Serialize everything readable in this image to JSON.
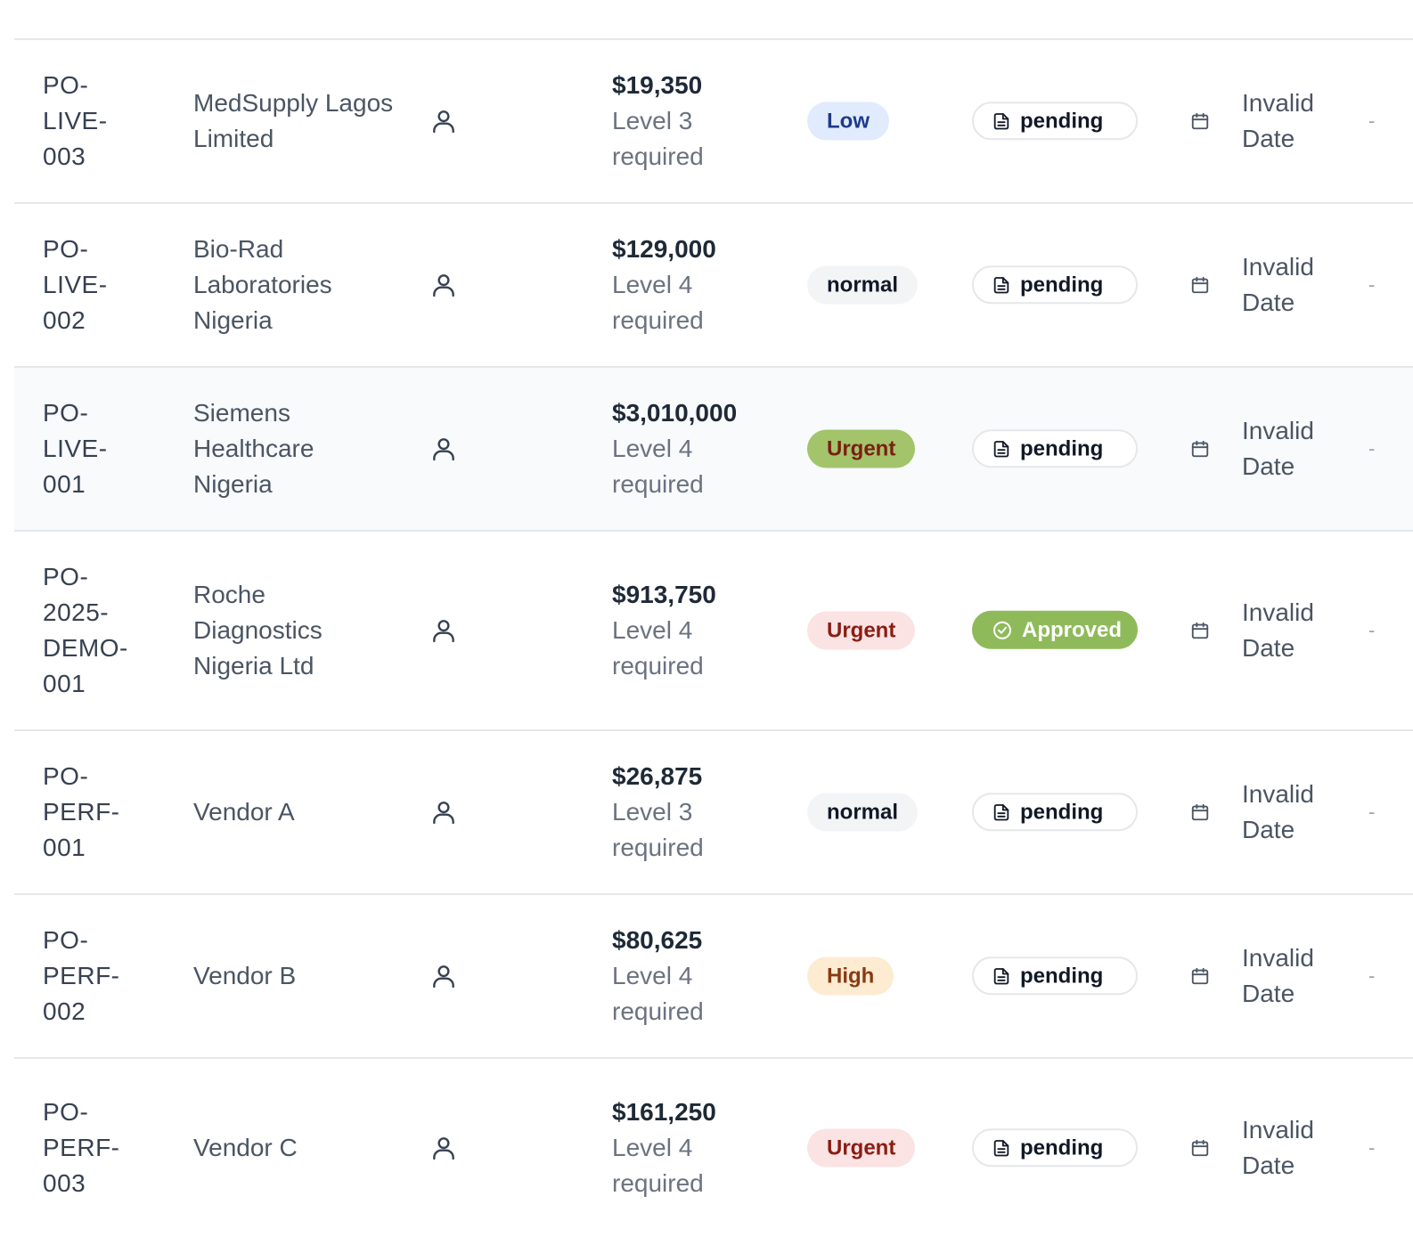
{
  "header": {
    "col_po": "",
    "col_vendor": "",
    "col_amount": ""
  },
  "orders": [
    {
      "po_number": "PO-\nLIVE-\n003",
      "vendor": "MedSupply Lagos Limited",
      "amount": "$19,350",
      "approval_level": "Level 3 required",
      "priority": "Low",
      "priority_style": "low",
      "status": "pending",
      "status_style": "pending",
      "date": "Invalid Date",
      "extra": "-"
    },
    {
      "po_number": "PO-\nLIVE-\n002",
      "vendor": "Bio-Rad Laboratories Nigeria",
      "amount": "$129,000",
      "approval_level": "Level 4 required",
      "priority": "normal",
      "priority_style": "normal",
      "status": "pending",
      "status_style": "pending",
      "date": "Invalid Date",
      "extra": "-"
    },
    {
      "po_number": "PO-\nLIVE-\n001",
      "vendor": "Siemens Healthcare Nigeria",
      "amount": "$3,010,000",
      "approval_level": "Level 4 required",
      "priority": "Urgent",
      "priority_style": "urgent-solid",
      "status": "pending",
      "status_style": "pending",
      "date": "Invalid Date",
      "extra": "-"
    },
    {
      "po_number": "PO-\n2025-\nDEMO-\n001",
      "vendor": "Roche Diagnostics Nigeria Ltd",
      "amount": "$913,750",
      "approval_level": "Level 4 required",
      "priority": "Urgent",
      "priority_style": "urgent-soft",
      "status": "Approved",
      "status_style": "approved",
      "date": "Invalid Date",
      "extra": "-"
    },
    {
      "po_number": "PO-\nPERF-\n001",
      "vendor": "Vendor A",
      "amount": "$26,875",
      "approval_level": "Level 3 required",
      "priority": "normal",
      "priority_style": "normal",
      "status": "pending",
      "status_style": "pending",
      "date": "Invalid Date",
      "extra": "-"
    },
    {
      "po_number": "PO-\nPERF-\n002",
      "vendor": "Vendor B",
      "amount": "$80,625",
      "approval_level": "Level 4 required",
      "priority": "High",
      "priority_style": "high",
      "status": "pending",
      "status_style": "pending",
      "date": "Invalid Date",
      "extra": "-"
    },
    {
      "po_number": "PO-\nPERF-\n003",
      "vendor": "Vendor C",
      "amount": "$161,250",
      "approval_level": "Level 4 required",
      "priority": "Urgent",
      "priority_style": "urgent-soft",
      "status": "pending",
      "status_style": "pending",
      "date": "Invalid Date",
      "extra": "-"
    }
  ],
  "icons": {
    "user": "user-icon",
    "status_pending": "document-icon",
    "status_approved": "check-circle-icon",
    "date": "calendar-icon"
  },
  "colors": {
    "row_highlight": "#f8fafc",
    "border": "#e5e7eb",
    "approved_green": "#8fba5a",
    "urgent_solid_green": "#a3c46a",
    "urgent_soft_red": "#fbe3e3",
    "low_blue": "#e0ebfd",
    "high_orange": "#fdecd2"
  }
}
